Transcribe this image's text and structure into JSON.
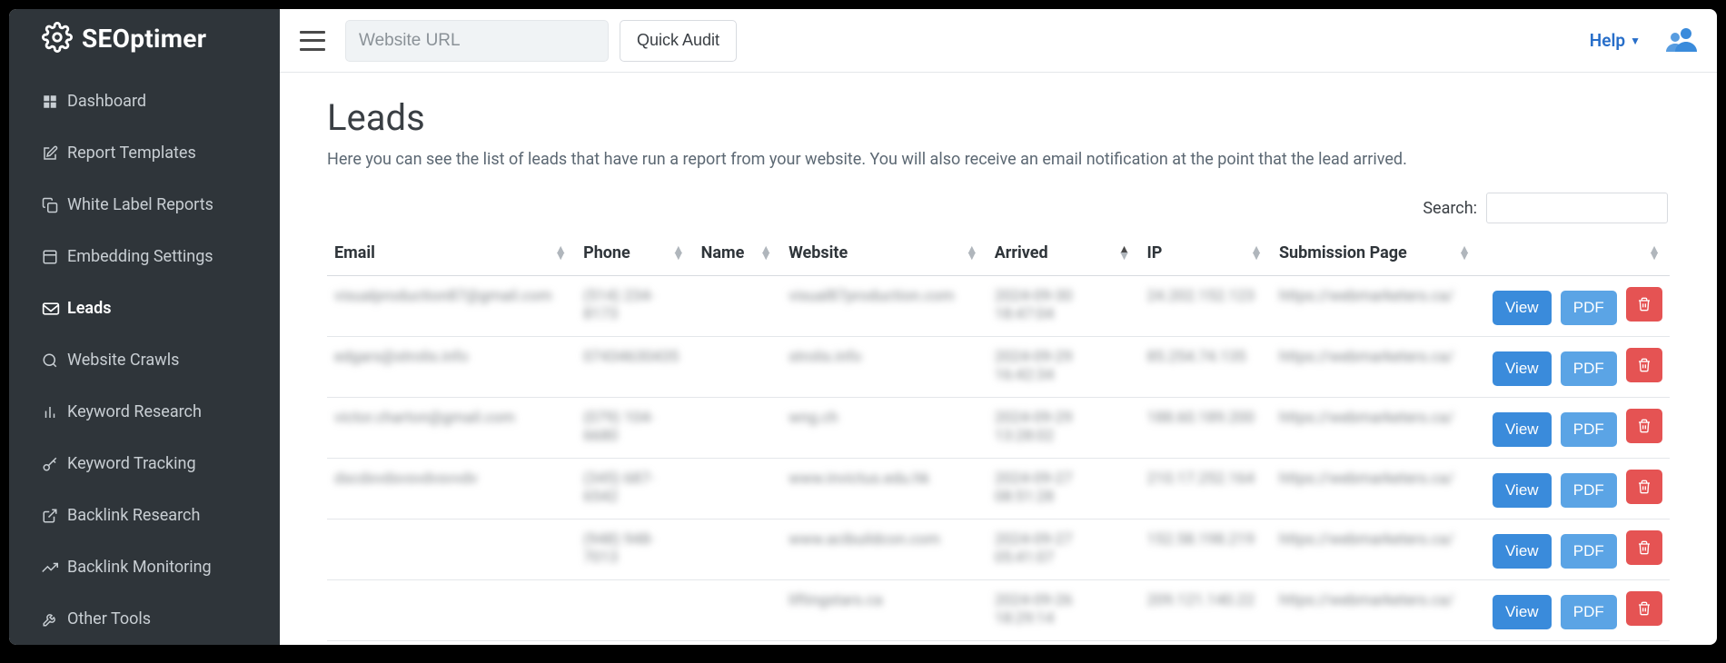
{
  "brand": {
    "name": "SEOptimer"
  },
  "sidebar": {
    "items": [
      {
        "label": "Dashboard",
        "icon": "dashboard-icon"
      },
      {
        "label": "Report Templates",
        "icon": "edit-icon"
      },
      {
        "label": "White Label Reports",
        "icon": "copy-icon"
      },
      {
        "label": "Embedding Settings",
        "icon": "embed-icon"
      },
      {
        "label": "Leads",
        "icon": "mail-icon",
        "active": true
      },
      {
        "label": "Website Crawls",
        "icon": "search-icon"
      },
      {
        "label": "Keyword Research",
        "icon": "bar-chart-icon"
      },
      {
        "label": "Keyword Tracking",
        "icon": "key-icon"
      },
      {
        "label": "Backlink Research",
        "icon": "external-link-icon"
      },
      {
        "label": "Backlink Monitoring",
        "icon": "trend-icon"
      },
      {
        "label": "Other Tools",
        "icon": "tool-icon"
      }
    ]
  },
  "topbar": {
    "url_placeholder": "Website URL",
    "quick_audit": "Quick Audit",
    "help": "Help"
  },
  "page": {
    "title": "Leads",
    "description": "Here you can see the list of leads that have run a report from your website. You will also receive an email notification at the point that the lead arrived.",
    "search_label": "Search:"
  },
  "table": {
    "columns": [
      "Email",
      "Phone",
      "Name",
      "Website",
      "Arrived",
      "IP",
      "Submission Page",
      ""
    ],
    "view_label": "View",
    "pdf_label": "PDF",
    "rows": [
      {
        "email": "visualproduction87@gmail.com",
        "phone": "(514) 234-8173",
        "name": "",
        "website": "visual87production.com",
        "arrived": "2024-09-30 18:47:04",
        "ip": "24.202.152.123",
        "submission": "https://webmarketers.ca/"
      },
      {
        "email": "edgars@strolis.info",
        "phone": "07434630435",
        "name": "",
        "website": "strolis.info",
        "arrived": "2024-09-29 16:42:34",
        "ip": "85.254.74.135",
        "submission": "https://webmarketers.ca/"
      },
      {
        "email": "victor.charton@gmail.com",
        "phone": "(079) 104-6680",
        "name": "",
        "website": "wng.ch",
        "arrived": "2024-09-29 13:28:02",
        "ip": "188.60.189.200",
        "submission": "https://webmarketers.ca/"
      },
      {
        "email": "dscdxvdsvsvdvsvvdv",
        "phone": "(345) 687-6542",
        "name": "",
        "website": "www.invictus.edu.hk",
        "arrived": "2024-09-27 08:51:28",
        "ip": "210.17.252.164",
        "submission": "https://webmarketers.ca/"
      },
      {
        "email": "",
        "phone": "(948) 948-7013",
        "name": "",
        "website": "www.acibuildcon.com",
        "arrived": "2024-09-27 05:41:07",
        "ip": "152.58.198.219",
        "submission": "https://webmarketers.ca/"
      },
      {
        "email": "",
        "phone": "",
        "name": "",
        "website": "liftingstars.ca",
        "arrived": "2024-09-26 18:29:14",
        "ip": "209.121.140.22",
        "submission": "https://webmarketers.ca/"
      }
    ]
  }
}
